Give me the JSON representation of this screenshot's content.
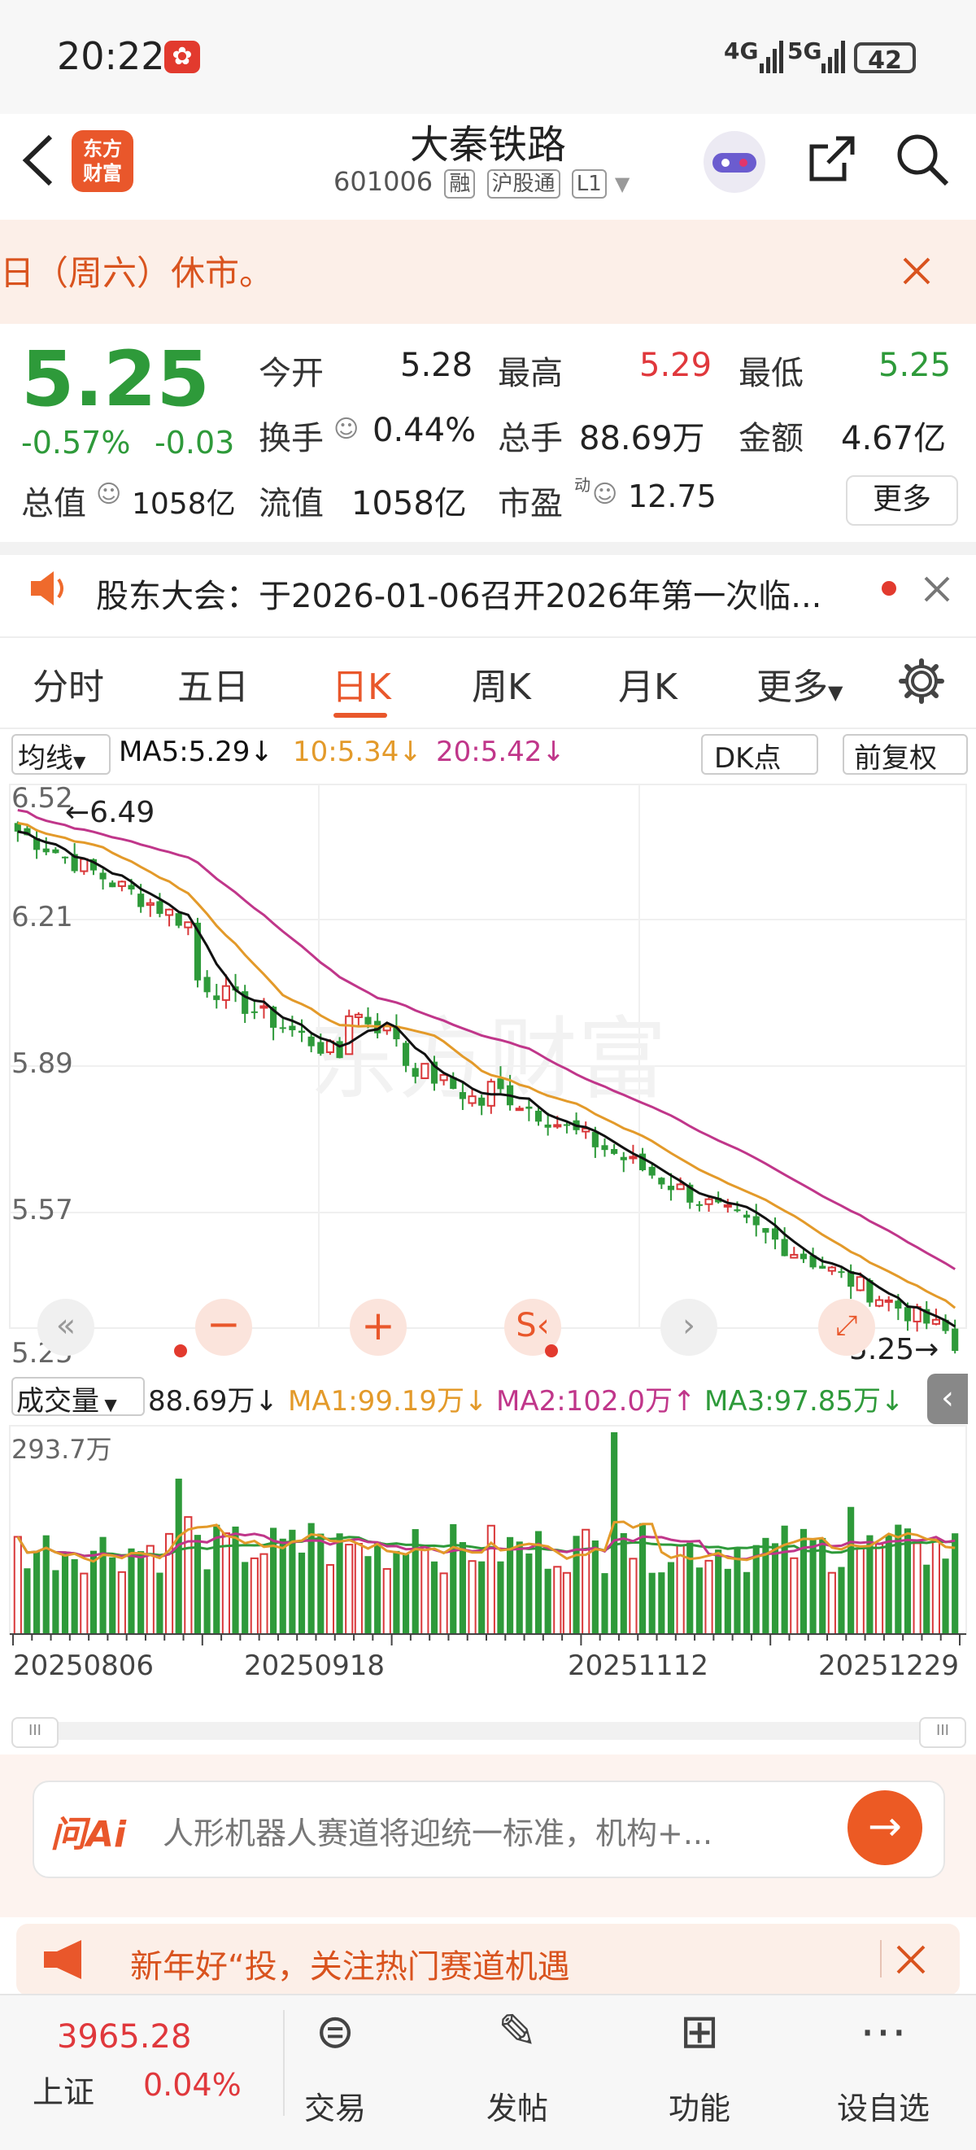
{
  "status": {
    "time": "20:22",
    "net1": "4G",
    "net2": "5G",
    "battery": "42"
  },
  "header": {
    "title": "大秦铁路",
    "code": "601006",
    "tags": [
      "融",
      "沪股通",
      "L1"
    ],
    "logo": "东方\n财富"
  },
  "banner": {
    "text": "日（周六）休市。"
  },
  "quote": {
    "price": "5.25",
    "pct": "-0.57%",
    "chg": "-0.03",
    "open_label": "今开",
    "open": "5.28",
    "high_label": "最高",
    "high": "5.29",
    "low_label": "最低",
    "low": "5.25",
    "turnover_label": "换手",
    "turnover": "0.44%",
    "vol_label": "总手",
    "vol": "88.69万",
    "amt_label": "金额",
    "amt": "4.67亿",
    "mcap_label": "总值",
    "mcap": "1058亿",
    "fmcap_label": "流值",
    "fmcap": "1058亿",
    "pe_label": "市盈",
    "pe_sup": "动",
    "pe": "12.75",
    "more": "更多"
  },
  "announce": {
    "text": "股东大会：于2026-01-06召开2026年第一次临..."
  },
  "tabs": [
    "分时",
    "五日",
    "日K",
    "周K",
    "月K",
    "更多"
  ],
  "active_tab": "日K",
  "chart": {
    "ma_selector": "均线",
    "ma5": "MA5:5.29↓",
    "ma10": "10:5.34↓",
    "ma20": "20:5.42↓",
    "dk": "DK点",
    "adjust": "前复权",
    "y_labels": [
      "6.52",
      "6.21",
      "5.89",
      "5.57",
      "5.25"
    ],
    "hi_label": "6.49",
    "last_label": "5.25",
    "watermark": "东方财富",
    "vol_selector": "成交量",
    "vol_value": "88.69万↓",
    "vma1": "MA1:99.19万↓",
    "vma2": "MA2:102.0万↑",
    "vma3": "MA3:97.85万↓",
    "vol_max": "293.7万",
    "dates": [
      "20250806",
      "20250918",
      "20251112",
      "20251229"
    ],
    "colors": {
      "up": "#d9383a",
      "down": "#2e9a3a",
      "ma5": "#111111",
      "ma10": "#e39a2a",
      "ma20": "#c0368a"
    }
  },
  "ai": {
    "brand": "问Ai",
    "text": "人形机器人赛道将迎统一标准，机构+..."
  },
  "promo": {
    "text": "新年好“投，关注热门赛道机遇"
  },
  "bottom": {
    "index_value": "3965.28",
    "index_name": "上证",
    "index_pct": "0.04%",
    "items": [
      {
        "label": "交易",
        "icon": "trade-icon"
      },
      {
        "label": "发帖",
        "icon": "post-icon"
      },
      {
        "label": "功能",
        "icon": "apps-icon"
      },
      {
        "label": "设自选",
        "icon": "more-icon"
      }
    ]
  }
}
